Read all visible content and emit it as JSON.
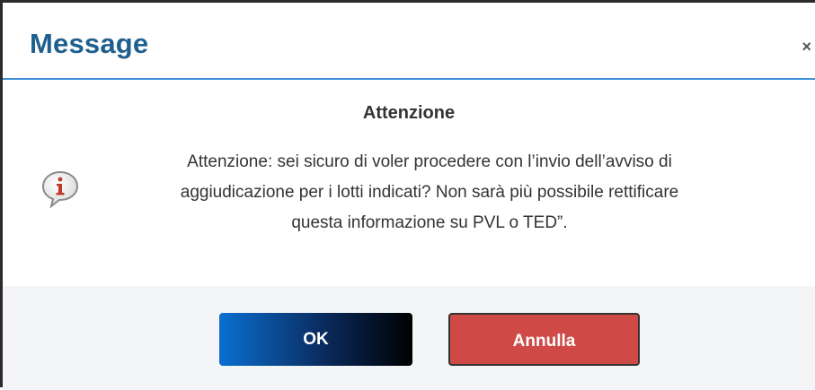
{
  "dialog": {
    "title": "Message",
    "close_symbol": "×",
    "heading": "Attenzione",
    "message_lines": [
      "Attenzione: sei sicuro di voler procedere con l’invio dell’avviso di",
      "aggiudicazione per i lotti indicati? Non sarà più possibile rettificare",
      "questa informazione su PVL o TED”."
    ],
    "icon": "info-speech-bubble-icon",
    "buttons": {
      "ok_label": "OK",
      "cancel_label": "Annulla"
    },
    "colors": {
      "title": "#1f5f8f",
      "header_rule": "#3a8fd6",
      "cancel_button": "#cf4a47",
      "icon_accent": "#c0392b"
    }
  }
}
